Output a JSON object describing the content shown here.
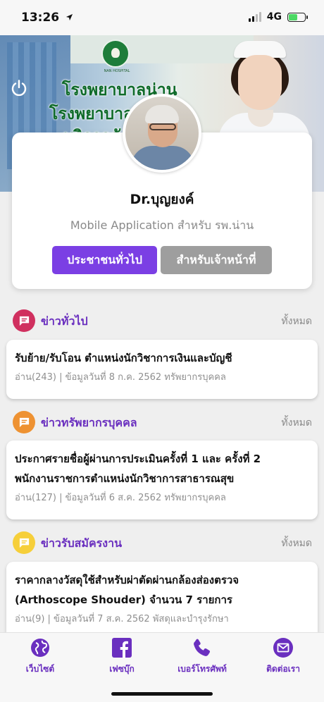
{
  "status": {
    "time": "13:26",
    "network": "4G"
  },
  "hero": {
    "lines": [
      "โรงพยาบาลน่าน",
      "โรงพยาบาล",
      "บริการดั"
    ],
    "logo_text": "NAN HOSPITAL"
  },
  "profile": {
    "name": "Dr.บุญยงค์",
    "subtitle": "Mobile Application สำหรับ รพ.น่าน",
    "btn_public": "ประชาชนทั่วไป",
    "btn_staff": "สำหรับเจ้าหน้าที่"
  },
  "sections": [
    {
      "title": "ข่าวทั่วไป",
      "all_label": "ทั้งหมด",
      "icon": "message-icon",
      "color": "#d0305f",
      "news_title": [
        "รับย้าย/รับโอน ตำแหน่งนักวิชาการเงินและบัญชี"
      ],
      "news_meta": "อ่าน(243) | ข้อมูลวันที่ 8 ก.ค. 2562 ทรัพยากรบุคคล"
    },
    {
      "title": "ข่าวทรัพยากรบุคคล",
      "all_label": "ทั้งหมด",
      "icon": "message-icon",
      "color": "#ee9232",
      "news_title": [
        "ประกาศรายชื่อผู้ผ่านการประเมินครั้งที่ 1 และ ครั้งที่ 2",
        "พนักงานราชการตำแหน่งนักวิชาการสาธารณสุข"
      ],
      "news_meta": "อ่าน(127) | ข้อมูลวันที่ 6 ส.ค. 2562 ทรัพยากรบุคคล"
    },
    {
      "title": "ข่าวรับสมัครงาน",
      "all_label": "ทั้งหมด",
      "icon": "message-icon",
      "color": "#f6cf3a",
      "news_title": [
        "ราคากลางวัสดุใช้สำหรับผ่าตัดผ่านกล้องส่องตรวจ",
        "(Arthoscope Shouder) จำนวน 7 รายการ"
      ],
      "news_meta": "อ่าน(9) | ข้อมูลวันที่ 7 ส.ค. 2562 พัสดุและบำรุงรักษา"
    }
  ],
  "nav": [
    {
      "label": "เว็บไซต์",
      "icon": "globe-icon"
    },
    {
      "label": "เฟซบุ๊ก",
      "icon": "facebook-icon"
    },
    {
      "label": "เบอร์โทรศัพท์",
      "icon": "phone-icon"
    },
    {
      "label": "ติดต่อเรา",
      "icon": "mail-icon"
    }
  ],
  "colors": {
    "accent": "#6a2fbf",
    "button_primary": "#7b3fe4",
    "button_secondary": "#9e9e9e"
  }
}
